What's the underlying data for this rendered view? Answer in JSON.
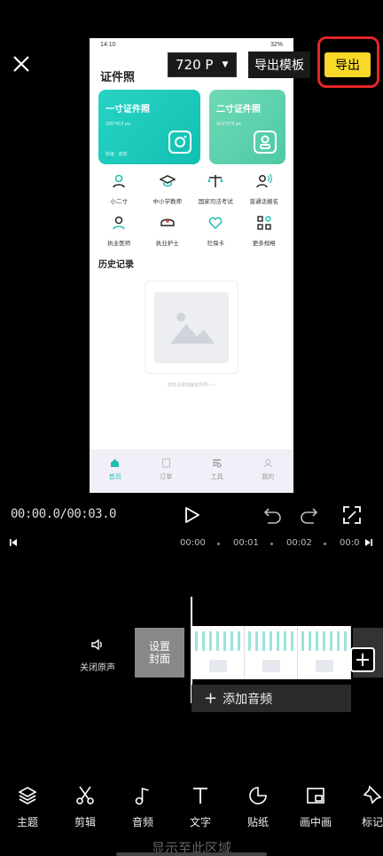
{
  "header": {
    "resolution": "720 P",
    "export_template": "导出模板",
    "export": "导出"
  },
  "preview": {
    "status_time": "14:10",
    "status_right": "32%",
    "title": "证件照",
    "cards": [
      {
        "title": "一寸证件照",
        "size": "295*413 px",
        "footer": "快速 · 高效"
      },
      {
        "title": "二寸证件照",
        "size": "413*579 px"
      }
    ],
    "grid": [
      [
        "小二寸",
        "中小学教师",
        "国家司法考试",
        "普通话报名"
      ],
      [
        "执业医师",
        "执业护士",
        "社保卡",
        "更多规格"
      ]
    ],
    "history_title": "历史记录",
    "empty_text": "您还没有拍摄证件照~~~",
    "tabs": [
      "首页",
      "订单",
      "工具",
      "我的"
    ]
  },
  "player": {
    "time": "00:00.0/00:03.0"
  },
  "ruler": [
    "00:00",
    "00:01",
    "00:02",
    "00:0"
  ],
  "timeline": {
    "mute_label": "关闭原声",
    "cover_label_1": "设置",
    "cover_label_2": "封面",
    "add_audio": "添加音频"
  },
  "toolbar": [
    "主题",
    "剪辑",
    "音频",
    "文字",
    "贴纸",
    "画中画",
    "标记"
  ],
  "footer_text": "显示至此区域",
  "colors": {
    "accent": "#f8d92a",
    "highlight": "#e32626",
    "brand": "#1fbfb0"
  }
}
